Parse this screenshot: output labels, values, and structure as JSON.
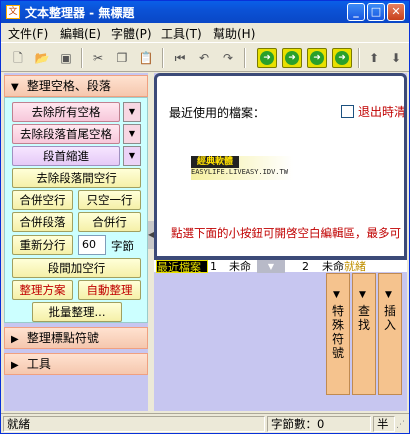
{
  "window": {
    "title": "文本整理器 - 無標題",
    "app_icon": "文",
    "min": "_",
    "max": "□",
    "close": "✕"
  },
  "menu": [
    "文件(F)",
    "編輯(E)",
    "字體(P)",
    "工具(T)",
    "幫助(H)"
  ],
  "toolbar": {
    "icons": [
      "new-file-icon",
      "open-file-icon",
      "save-icon",
      "cut-icon",
      "copy-icon",
      "paste-icon",
      "first-icon",
      "undo-icon",
      "redo-icon",
      "green-arrow-1-icon",
      "green-arrow-2-icon",
      "green-arrow-3-icon",
      "green-arrow-4-icon",
      "up-icon",
      "down-icon"
    ]
  },
  "left": {
    "group1_title": "整理空格、段落",
    "btn_remove_all_spaces": "去除所有空格",
    "btn_remove_head_tail": "去除段落首尾空格",
    "btn_indent": "段首縮進",
    "btn_remove_blank_lines": "去除段落間空行",
    "btn_merge_blank": "合併空行",
    "btn_keep_one": "只空一行",
    "btn_merge_para": "合併段落",
    "btn_merge_line": "合併行",
    "btn_rewrap": "重新分行",
    "rewrap_value": "60",
    "rewrap_unit": "字節",
    "btn_add_blank": "段間加空行",
    "btn_scheme": "整理方案",
    "btn_auto": "自動整理",
    "btn_batch": "批量整理...",
    "group2_title": "整理標點符號",
    "group3_title": "工具"
  },
  "right": {
    "recent_title": "最近使用的檔案：",
    "exit_label": "退出時清",
    "logo_line1": "經典軟體",
    "logo_line2": "EASYLIFE.LIVEASY.IDV.TW",
    "hint": "點選下面的小按鈕可開啓空白編輯區，最多可",
    "tab_recent": "最近檔案",
    "tab_num1": "1",
    "tab_untitled1": "未命",
    "tab_num2": "2",
    "tab_untitled2": "未命",
    "tab_ready": "就緒",
    "vtab1": "特殊符號",
    "vtab2": "查找",
    "vtab3": "插入"
  },
  "status": {
    "left": "就緒",
    "bytes": "字節數：0",
    "mode": "半"
  }
}
